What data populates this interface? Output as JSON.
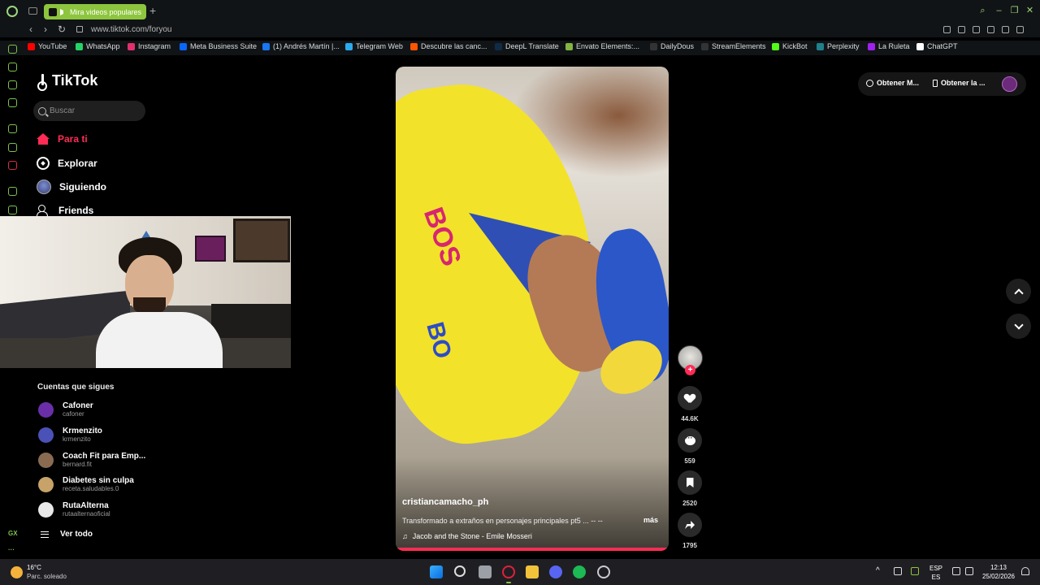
{
  "browser": {
    "tab_title": "Mira videos populares",
    "new_tab": "+",
    "url": "www.tiktok.com/foryou",
    "rail_label": "GX",
    "rail_more": "···"
  },
  "bookmarks": [
    {
      "label": "YouTube",
      "color": "#ff0000"
    },
    {
      "label": "WhatsApp",
      "color": "#25d366"
    },
    {
      "label": "Instagram",
      "color": "#e1306c"
    },
    {
      "label": "Meta Business Suite",
      "color": "#0866ff"
    },
    {
      "label": "(1) Andrés Martín |...",
      "color": "#1877f2"
    },
    {
      "label": "Telegram Web",
      "color": "#2aabee"
    },
    {
      "label": "Descubre las canc...",
      "color": "#ff5500"
    },
    {
      "label": "DeepL Translate",
      "color": "#0f2b46"
    },
    {
      "label": "Envato Elements:...",
      "color": "#82b541"
    },
    {
      "label": "DailyDous",
      "color": "#333333"
    },
    {
      "label": "StreamElements",
      "color": "#333333"
    },
    {
      "label": "KickBot",
      "color": "#53fc18"
    },
    {
      "label": "Perplexity",
      "color": "#20808d"
    },
    {
      "label": "La Ruleta",
      "color": "#a020f0"
    },
    {
      "label": "ChatGPT",
      "color": "#ffffff"
    }
  ],
  "tiktok": {
    "brand": "TikTok",
    "search_placeholder": "Buscar",
    "nav": {
      "for_you": "Para ti",
      "explore": "Explorar",
      "following": "Siguiendo",
      "friends": "Friends"
    },
    "following_heading": "Cuentas que sigues",
    "accounts": [
      {
        "name": "Cafoner",
        "handle": "cafoner",
        "color": "#6a2fa8"
      },
      {
        "name": "Krmenzito",
        "handle": "krmenzito",
        "color": "#4a52b8"
      },
      {
        "name": "Coach Fit para Emp...",
        "handle": "bernard.fit",
        "color": "#8a6b52"
      },
      {
        "name": "Diabetes sin culpa",
        "handle": "receta.saludables.0",
        "color": "#c7a36a"
      },
      {
        "name": "RutaAlterna",
        "handle": "rutaalternaoficial",
        "color": "#e8e8e8"
      }
    ],
    "see_all": "Ver todo",
    "get_app_1": "Obtener M...",
    "get_app_2": "Obtener la ..."
  },
  "video": {
    "username": "cristiancamacho_ph",
    "description": "Transformado a extraños en personajes principales pt5 ... -- --",
    "more": "más",
    "music": "Jacob and the Stone - Emile Mosseri",
    "music_icon": "♫",
    "progress": 1.0,
    "likes": "44.6K",
    "comments": "559",
    "saves": "2520",
    "shares": "1795",
    "follow_plus": "+"
  },
  "taskbar": {
    "temperature": "16°C",
    "weather": "Parc. soleado",
    "lang_top": "ESP",
    "lang_bottom": "ES",
    "time": "12:13",
    "date": "25/02/2026"
  }
}
